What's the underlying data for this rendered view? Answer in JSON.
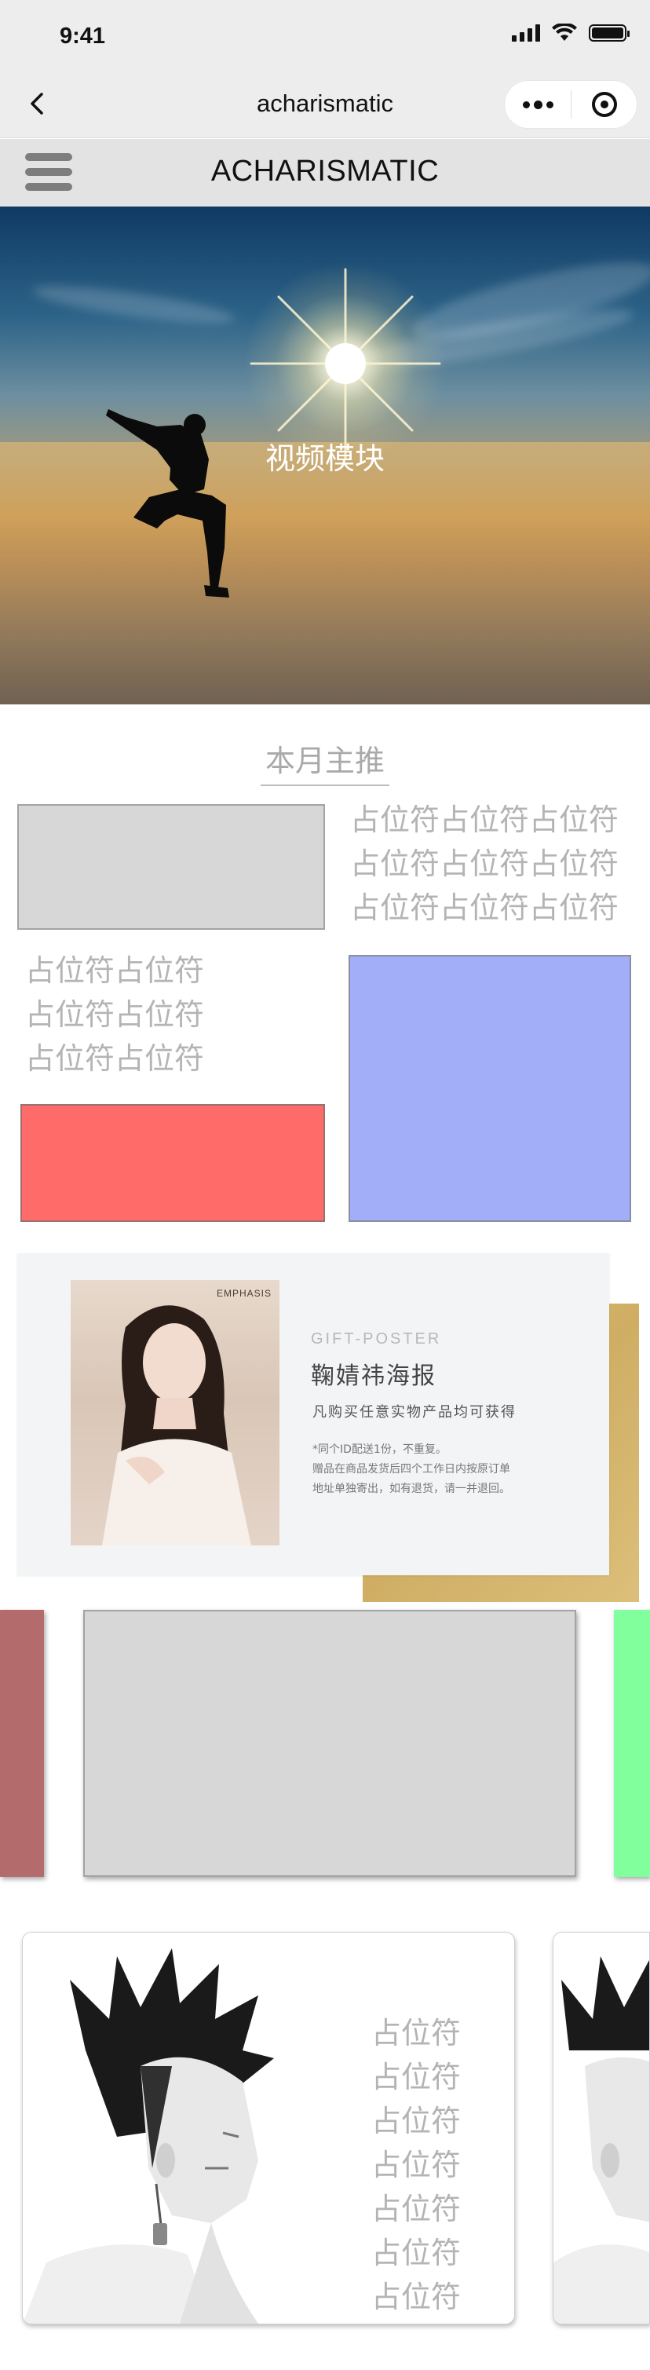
{
  "status_bar": {
    "time": "9:41"
  },
  "nav": {
    "title": "acharismatic"
  },
  "app_header": {
    "brand": "ACHARISMATIC"
  },
  "hero": {
    "caption": "视频模块"
  },
  "section": {
    "title": "本月主推"
  },
  "featured": {
    "right_text_lines": [
      "占位符占位符占位符",
      "占位符占位符占位符",
      "占位符占位符占位符"
    ],
    "left_text_lines": [
      "占位符占位符",
      "占位符占位符",
      "占位符占位符"
    ],
    "colors": {
      "gray": "#d7d7d7",
      "blue": "#a3aef9",
      "red": "#ff6b69"
    }
  },
  "poster": {
    "brand": "EMPHASIS",
    "label": "GIFT-POSTER",
    "title": "鞠婧祎海报",
    "desc": "凡购买任意实物产品均可获得",
    "note_lines": [
      "*同个ID配送1份，不重复。",
      "赠品在商品发货后四个工作日内按原订单",
      "地址单独寄出，如有退货，请一并退回。"
    ]
  },
  "carousel": {
    "colors": {
      "left": "#b36b6b",
      "center": "#d7d7d7",
      "right": "#80ff9c"
    }
  },
  "profile_card": {
    "text_lines": [
      "占位符",
      "占位符",
      "占位符",
      "占位符",
      "占位符",
      "占位符",
      "占位符"
    ]
  }
}
